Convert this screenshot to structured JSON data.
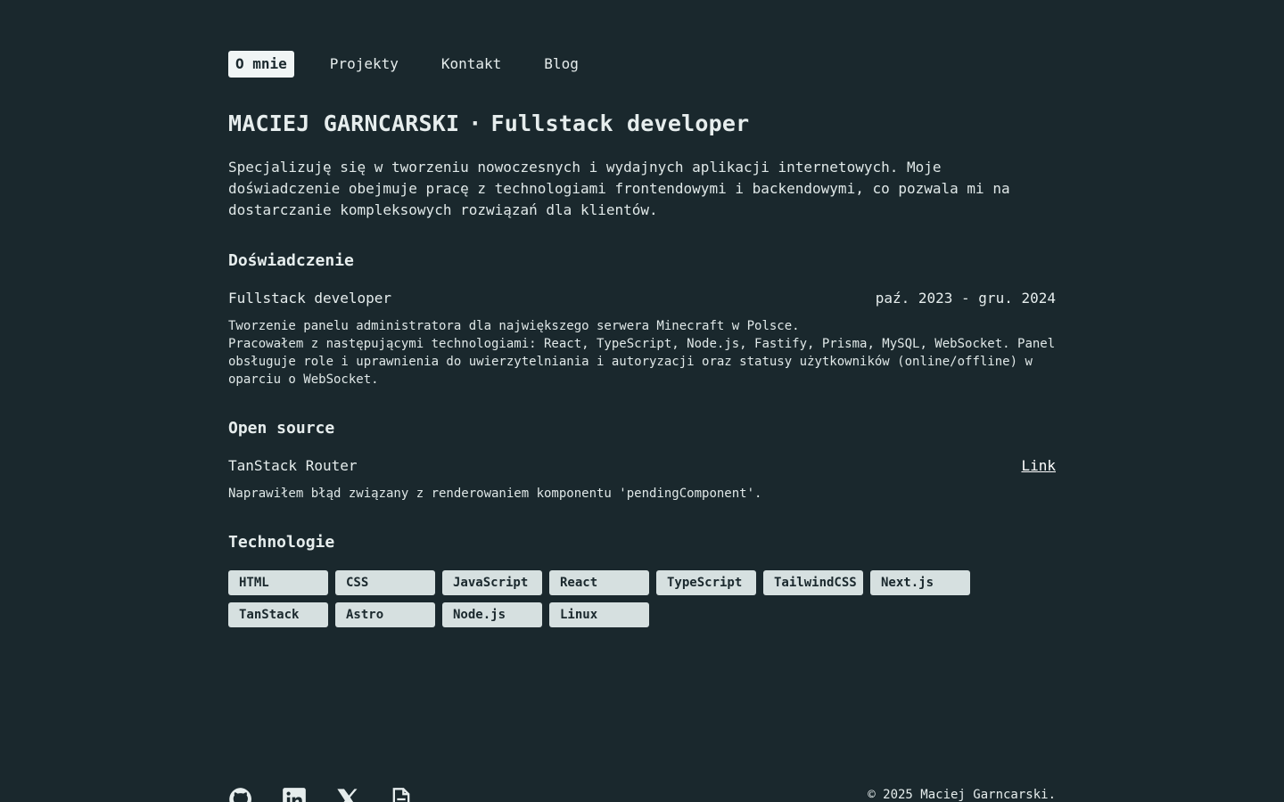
{
  "nav": {
    "items": [
      {
        "label": "O mnie",
        "active": true
      },
      {
        "label": "Projekty",
        "active": false
      },
      {
        "label": "Kontakt",
        "active": false
      },
      {
        "label": "Blog",
        "active": false
      }
    ]
  },
  "header": {
    "name": "MACIEJ GARNCARSKI",
    "separator": "·",
    "role": "Fullstack developer"
  },
  "intro": "Specjalizuję się w tworzeniu nowoczesnych i wydajnych aplikacji internetowych. Moje doświadczenie obejmuje pracę z technologiami frontendowymi i backendowymi, co pozwala mi na dostarczanie kompleksowych rozwiązań dla klientów.",
  "experience": {
    "heading": "Doświadczenie",
    "items": [
      {
        "title": "Fullstack developer",
        "dates": "paź. 2023 - gru. 2024",
        "line1": "Tworzenie panelu administratora dla największego serwera Minecraft w Polsce.",
        "line2": "Pracowałem z następującymi technologiami: React, TypeScript, Node.js, Fastify, Prisma, MySQL, WebSocket. Panel obsługuje role i uprawnienia do uwierzytelniania i autoryzacji oraz statusy użytkowników (online/offline) w oparciu o WebSocket."
      }
    ]
  },
  "opensource": {
    "heading": "Open source",
    "items": [
      {
        "title": "TanStack Router",
        "link_label": "Link",
        "description": "Naprawiłem błąd związany z renderowaniem komponentu 'pendingComponent'."
      }
    ]
  },
  "technologies": {
    "heading": "Technologie",
    "tags": [
      "HTML",
      "CSS",
      "JavaScript",
      "React",
      "TypeScript",
      "TailwindCSS",
      "Next.js",
      "TanStack",
      "Astro",
      "Node.js",
      "Linux"
    ]
  },
  "footer": {
    "icons": [
      "github-icon",
      "linkedin-icon",
      "x-icon",
      "document-icon"
    ],
    "copyright": "© 2025 Maciej Garncarski."
  },
  "colors": {
    "background": "#1a282d",
    "text": "#e6eded",
    "tag_background": "#d6e0e0"
  }
}
